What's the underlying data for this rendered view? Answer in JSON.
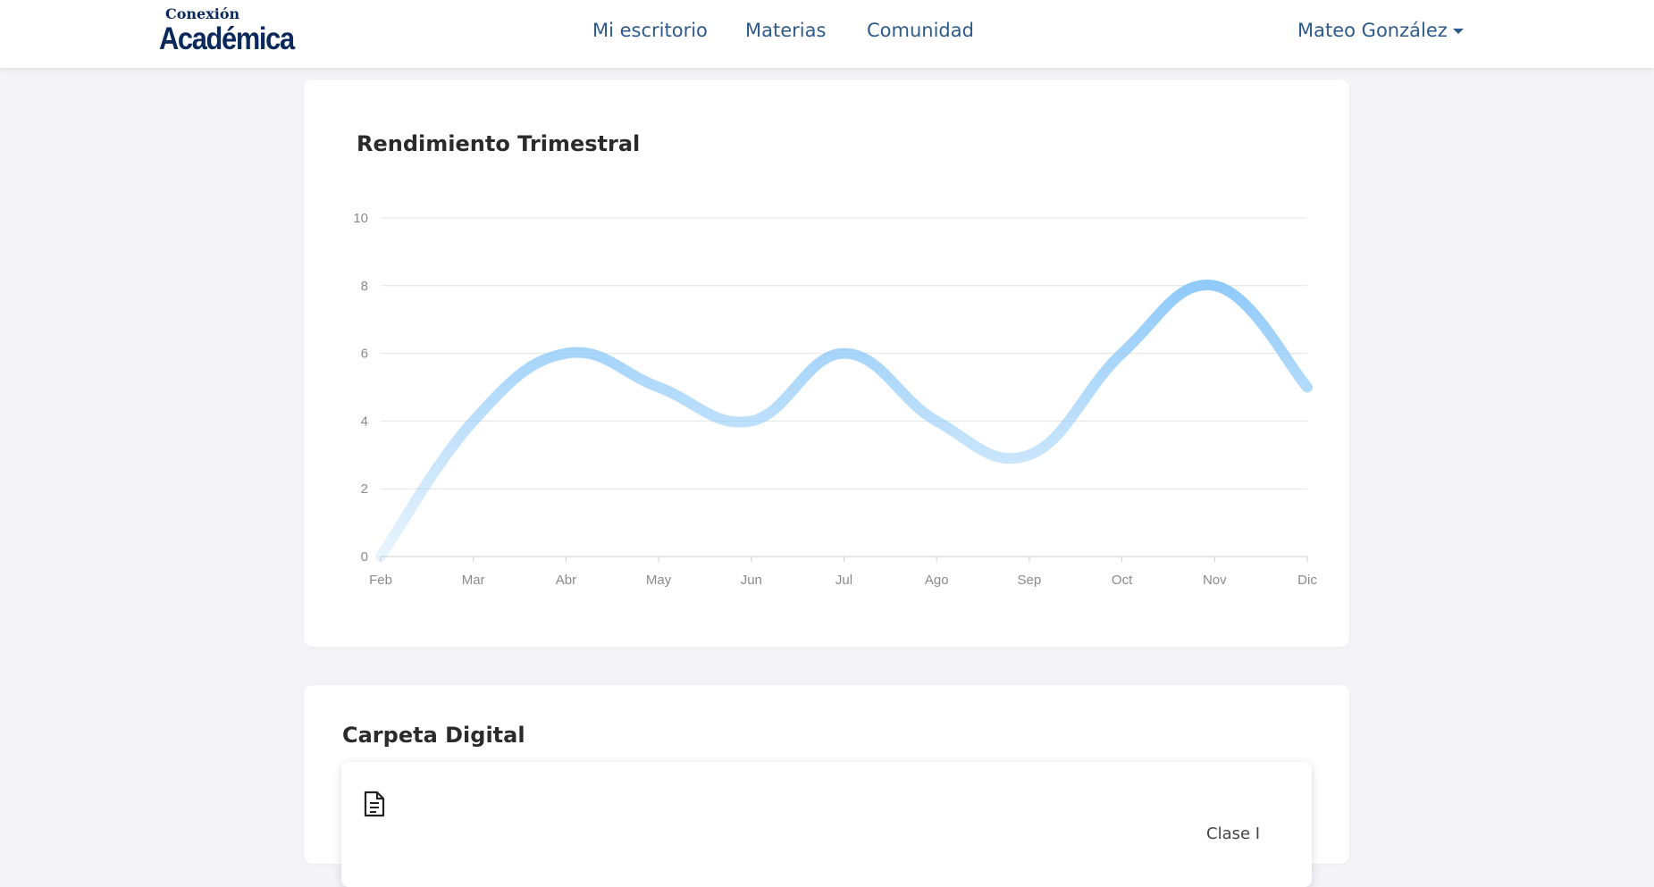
{
  "brand": {
    "top": "Conexión",
    "bottom": "Académica"
  },
  "nav": {
    "links": [
      "Mi escritorio",
      "Materias",
      "Comunidad"
    ],
    "user": "Mateo González"
  },
  "performance": {
    "title": "Rendimiento Trimestral",
    "chart_data": {
      "type": "line",
      "categories": [
        "Feb",
        "Mar",
        "Abr",
        "May",
        "Jun",
        "Jul",
        "Ago",
        "Sep",
        "Oct",
        "Nov",
        "Dic"
      ],
      "series": [
        {
          "values": [
            0,
            4,
            6,
            5,
            4,
            6,
            4,
            3,
            6,
            8,
            5
          ]
        }
      ],
      "yticks": [
        0,
        2,
        4,
        6,
        8,
        10
      ],
      "ylim": [
        0,
        10
      ],
      "grid": true,
      "line_color": "#90caf9"
    }
  },
  "folder": {
    "title": "Carpeta Digital",
    "document_icon": "document-icon",
    "side_text": "Clase I"
  }
}
